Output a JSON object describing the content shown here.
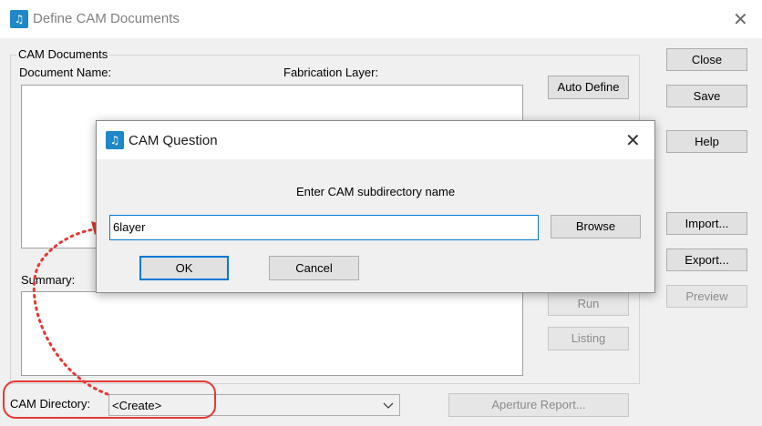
{
  "window": {
    "title": "Define CAM Documents"
  },
  "cam_documents": {
    "group_label": "CAM Documents",
    "document_name_header": "Document Name:",
    "fabrication_layer_header": "Fabrication Layer:",
    "summary_label": "Summary:"
  },
  "buttons": {
    "auto_define": "Auto Define",
    "close": "Close",
    "save": "Save",
    "help": "Help",
    "import": "Import...",
    "export": "Export...",
    "preview": "Preview",
    "run": "Run",
    "listing": "Listing",
    "aperture_report": "Aperture Report..."
  },
  "cam_directory": {
    "label": "CAM Directory:",
    "value": "<Create>"
  },
  "dialog": {
    "title": "CAM Question",
    "prompt": "Enter CAM subdirectory name",
    "input_value": "6layer",
    "browse": "Browse",
    "ok": "OK",
    "cancel": "Cancel"
  },
  "icons": {
    "app": "app-logo-icon",
    "close": "close-icon",
    "dropdown": "chevron-down-icon"
  },
  "colors": {
    "annotation": "#e53935",
    "focus": "#0078d7",
    "app_icon": "#1e88c8"
  }
}
